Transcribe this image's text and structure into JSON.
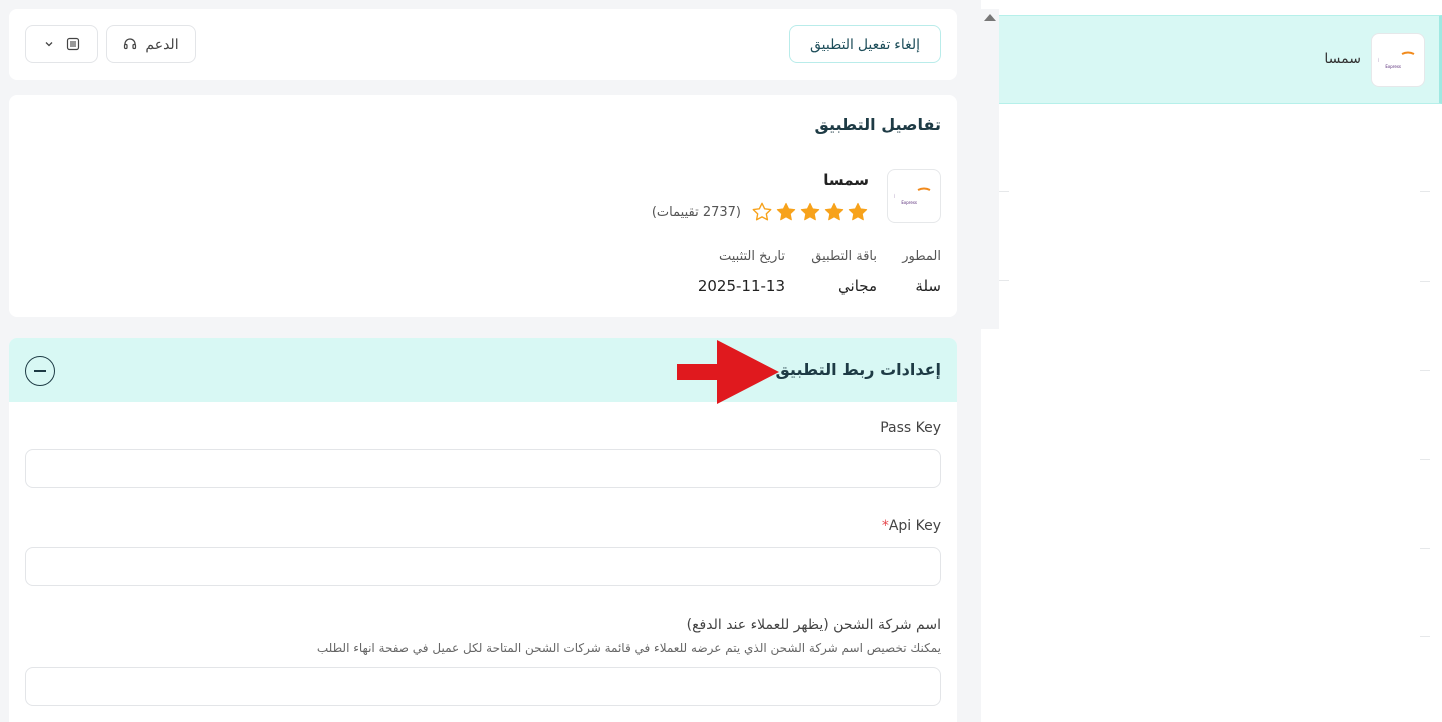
{
  "topbar": {
    "deactivate_label": "إلغاء تفعيل التطبيق",
    "support_label": "الدعم"
  },
  "details": {
    "title": "تفاصيل التطبيق",
    "app_name": "سمسا",
    "logo_text_main": "smsa",
    "logo_text_sub": "Express",
    "rating": 4,
    "rating_max": 5,
    "rating_text": "(2737 تقييمات)",
    "meta": {
      "developer_label": "المطور",
      "developer_value": "سلة",
      "plan_label": "باقة التطبيق",
      "plan_value": "مجاني",
      "install_date_label": "تاريخ التثبيت",
      "install_date_value": "2025-11-13"
    }
  },
  "settings": {
    "title": "إعدادات ربط التطبيق",
    "fields": [
      {
        "label": "Pass Key",
        "required": false,
        "value": ""
      },
      {
        "label": "Api Key",
        "required": true,
        "value": ""
      },
      {
        "label": "اسم شركة الشحن (يظهر للعملاء عند الدفع)",
        "hint": "يمكنك تخصيص اسم شركة الشحن الذي يتم عرضه للعملاء في قائمة شركات الشحن المتاحة لكل عميل في صفحة انهاء الطلب",
        "required": false,
        "value": ""
      }
    ]
  },
  "sidebar": {
    "items": [
      {
        "label": "سمسا",
        "logo_text_main": "smsa",
        "logo_text_sub": "Express",
        "active": true
      }
    ]
  },
  "colors": {
    "accent_bg": "#d8f8f4",
    "star": "#f7a21b",
    "arrow": "#e0191e",
    "logo_purple": "#4b1c6e",
    "logo_orange": "#f18a1c"
  }
}
